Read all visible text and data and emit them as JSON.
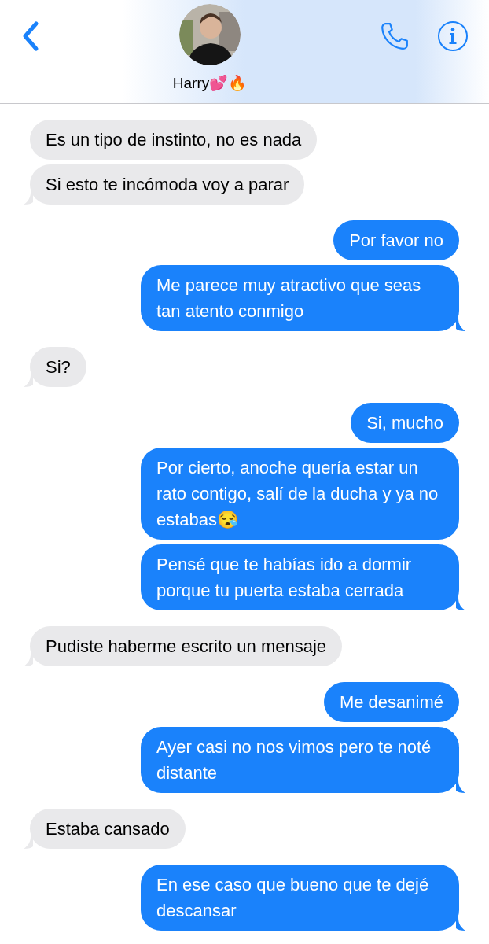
{
  "header": {
    "contact_name": "Harry💕🔥"
  },
  "messages": [
    {
      "kind": "received",
      "text": "Es un tipo de instinto, no es nada",
      "tail": false
    },
    {
      "kind": "received",
      "text": "Si esto te incómoda voy a parar",
      "tail": true
    },
    {
      "kind": "sent",
      "text": "Por favor no",
      "tail": false
    },
    {
      "kind": "sent",
      "text": "Me parece muy atractivo que seas tan atento conmigo",
      "tail": true
    },
    {
      "kind": "received",
      "text": "Si?",
      "tail": true
    },
    {
      "kind": "sent",
      "text": "Si, mucho",
      "tail": false
    },
    {
      "kind": "sent",
      "text": "Por cierto, anoche quería estar un rato contigo, salí de la ducha y ya no estabas😪",
      "tail": false
    },
    {
      "kind": "sent",
      "text": "Pensé que te habías ido a dormir porque tu puerta estaba cerrada",
      "tail": true
    },
    {
      "kind": "received",
      "text": "Pudiste haberme escrito un mensaje",
      "tail": true
    },
    {
      "kind": "sent",
      "text": "Me desanimé",
      "tail": false
    },
    {
      "kind": "sent",
      "text": "Ayer casi no nos vimos pero te noté distante",
      "tail": true
    },
    {
      "kind": "received",
      "text": "Estaba cansado",
      "tail": true
    },
    {
      "kind": "sent",
      "text": "En ese caso que bueno que te dejé descansar",
      "tail": true
    }
  ]
}
